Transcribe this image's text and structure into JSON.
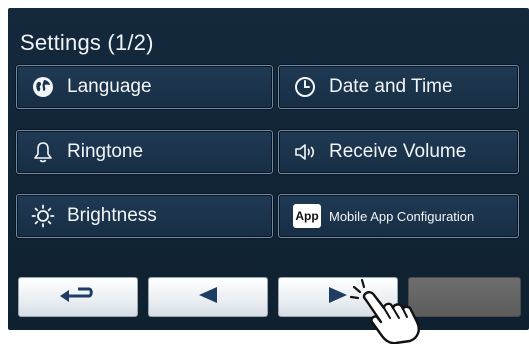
{
  "screen": {
    "title": "Settings (1/2)"
  },
  "menu": {
    "items": [
      {
        "label": "Language",
        "icon": "globe-icon"
      },
      {
        "label": "Date and Time",
        "icon": "clock-icon"
      },
      {
        "label": "Ringtone",
        "icon": "bell-icon"
      },
      {
        "label": "Receive Volume",
        "icon": "speaker-icon"
      },
      {
        "label": "Brightness",
        "icon": "sun-icon"
      },
      {
        "label": "Mobile App Configuration",
        "icon": "app-icon",
        "badge": "App"
      }
    ]
  },
  "nav": {
    "back_icon": "return-arrow-icon",
    "prev_icon": "left-triangle-icon",
    "next_icon": "right-triangle-icon",
    "fourth_state": "disabled"
  },
  "overlay": {
    "pointer": "tapping-hand-icon"
  },
  "colors": {
    "screen_bg": "#14293d",
    "tile_border": "#6f8aa3",
    "accent_arrow": "#1f3d63",
    "text": "#f1f4f7"
  }
}
